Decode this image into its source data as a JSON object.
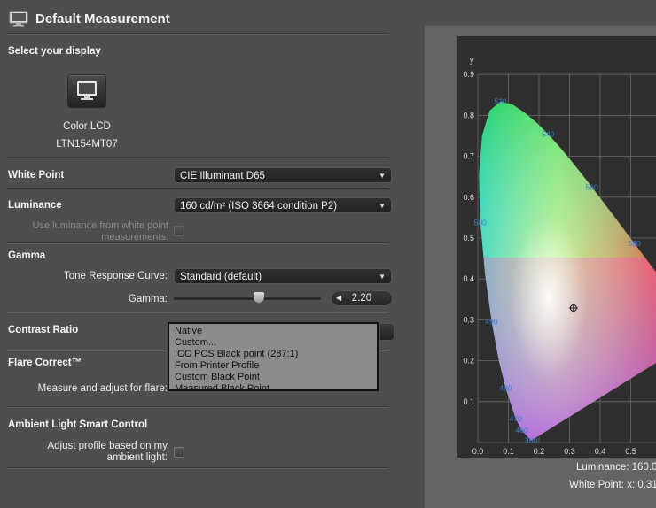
{
  "window": {
    "title": "Default Measurement"
  },
  "display": {
    "section": "Select your display",
    "name": "Color LCD",
    "model": "LTN154MT07"
  },
  "white_point": {
    "label": "White Point",
    "value": "CIE Illuminant D65"
  },
  "luminance": {
    "label": "Luminance",
    "value": "160 cd/m² (ISO 3664 condition P2)",
    "use_from_wp_line1": "Use luminance from white point",
    "use_from_wp_line2": "measurements:"
  },
  "gamma": {
    "section": "Gamma",
    "trc_label": "Tone Response Curve:",
    "trc_value": "Standard (default)",
    "gamma_label": "Gamma:",
    "gamma_value": "2.20",
    "slider_level": 0.58
  },
  "contrast": {
    "label": "Contrast Ratio",
    "menu": [
      "Native",
      "Custom...",
      "ICC PCS Black point (287:1)",
      "From Printer Profile",
      "Custom Black Point",
      "Measured Black Point"
    ]
  },
  "flare": {
    "section": "Flare Correct™",
    "label": "Measure and adjust for flare:"
  },
  "ambient": {
    "section": "Ambient Light Smart Control",
    "line1": "Adjust profile based on my",
    "line2": "ambient light:"
  },
  "chart_data": {
    "type": "scatter",
    "title": "",
    "xlabel": "",
    "ylabel": "y",
    "xlim": [
      0.0,
      0.55
    ],
    "ylim": [
      0.0,
      0.9
    ],
    "x_ticks": [
      "0.0",
      "0.1",
      "0.2",
      "0.3",
      "0.4",
      "0.5"
    ],
    "y_ticks": [
      "0.0",
      "0.1",
      "0.2",
      "0.3",
      "0.4",
      "0.5",
      "0.6",
      "0.7",
      "0.8",
      "0.9"
    ],
    "wavelength_labels": [
      {
        "label": "520",
        "x": 0.074,
        "y": 0.834
      },
      {
        "label": "540",
        "x": 0.23,
        "y": 0.754
      },
      {
        "label": "560",
        "x": 0.373,
        "y": 0.624
      },
      {
        "label": "580",
        "x": 0.512,
        "y": 0.487
      },
      {
        "label": "500",
        "x": 0.008,
        "y": 0.538
      },
      {
        "label": "490",
        "x": 0.045,
        "y": 0.295
      },
      {
        "label": "480",
        "x": 0.091,
        "y": 0.133
      },
      {
        "label": "470",
        "x": 0.124,
        "y": 0.058
      },
      {
        "label": "460",
        "x": 0.144,
        "y": 0.03
      },
      {
        "label": "380",
        "x": 0.174,
        "y": 0.005
      }
    ],
    "white_point": {
      "x": 0.3127,
      "y": 0.329
    },
    "grid": true
  },
  "readouts": {
    "luminance": "Luminance: 160.0",
    "white_point": "White Point: x: 0.31"
  }
}
